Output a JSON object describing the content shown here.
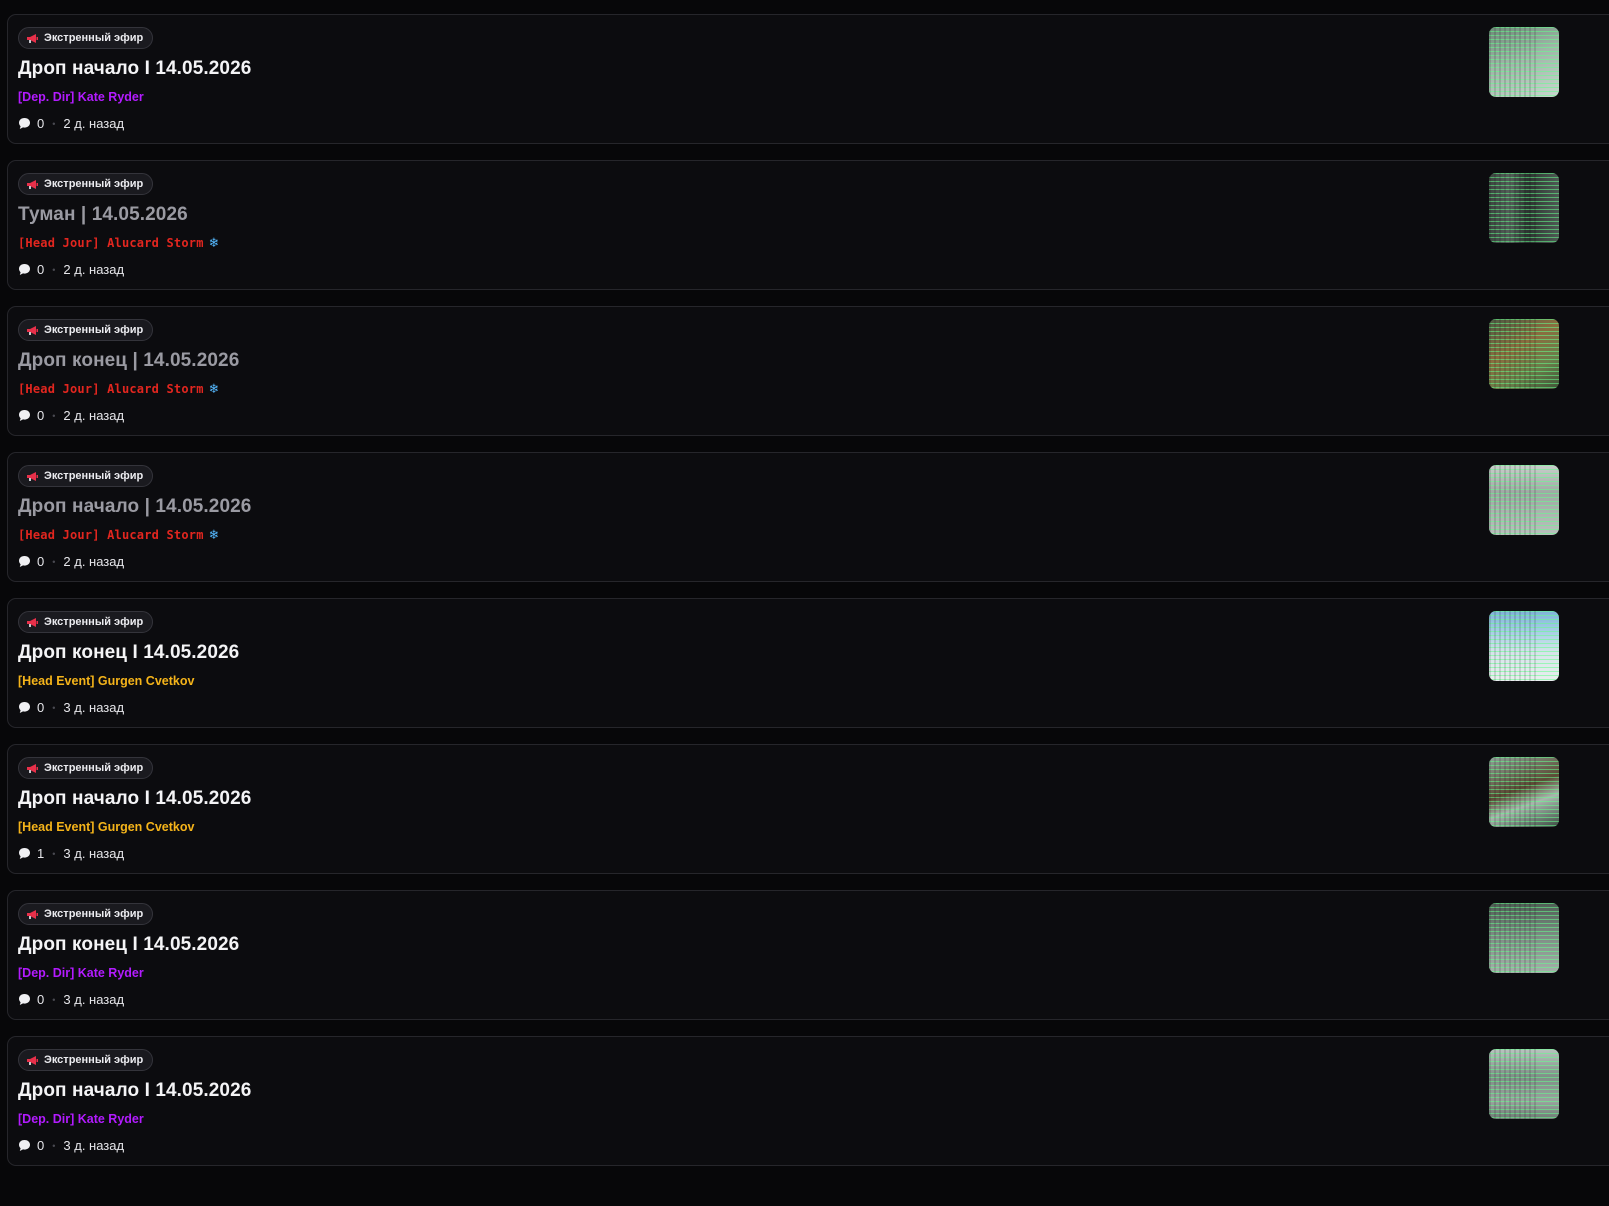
{
  "badge_label": "Экстренный эфир",
  "colors": {
    "dep_dir": "#b31bff",
    "head_jour": "#e2261f",
    "head_event": "#f5b41a",
    "snowflake": "#55b9ff"
  },
  "threads": [
    {
      "badge": "Экстренный эфир",
      "badge_icon": "megaphone-icon",
      "title": "Дроп начало I 14.05.2026",
      "read": false,
      "author": "[Dep. Dir] Kate Ryder",
      "author_color": "#b31bff",
      "author_style": "normal",
      "author_icon": "",
      "comments": "0",
      "time": "2 д. назад",
      "thumb_bg": "linear-gradient(160deg,#6d8a78 0%,#9fb5a8 45%,#c9d6cf 100%)"
    },
    {
      "badge": "Экстренный эфир",
      "badge_icon": "megaphone-icon",
      "title": "Туман | 14.05.2026",
      "read": true,
      "author": "[Head Jour] Alucard Storm",
      "author_color": "#e2261f",
      "author_style": "pixel",
      "author_icon": "❄",
      "comments": "0",
      "time": "2 д. назад",
      "thumb_bg": "linear-gradient(90deg,#3c4440 0%,#55605a 30%,#2c3330 55%,#4f5a55 100%)"
    },
    {
      "badge": "Экстренный эфир",
      "badge_icon": "megaphone-icon",
      "title": "Дроп конец | 14.05.2026",
      "read": true,
      "author": "[Head Jour] Alucard Storm",
      "author_color": "#e2261f",
      "author_style": "pixel",
      "author_icon": "❄",
      "comments": "0",
      "time": "2 д. назад",
      "thumb_bg": "linear-gradient(150deg,#4d5a44 0%,#8a6d3f 40%,#6b7d4a 70%,#3f5237 100%)"
    },
    {
      "badge": "Экстренный эфир",
      "badge_icon": "megaphone-icon",
      "title": "Дроп начало | 14.05.2026",
      "read": true,
      "author": "[Head Jour] Alucard Storm",
      "author_color": "#e2261f",
      "author_style": "pixel",
      "author_icon": "❄",
      "comments": "0",
      "time": "2 д. назад",
      "thumb_bg": "linear-gradient(180deg,#c9cfcc 0%,#9fa8a4 40%,#b9c1bd 100%)"
    },
    {
      "badge": "Экстренный эфир",
      "badge_icon": "megaphone-icon",
      "title": "Дроп конец I 14.05.2026",
      "read": false,
      "author": "[Head Event] Gurgen Cvetkov",
      "author_color": "#f5b41a",
      "author_style": "normal",
      "author_icon": "",
      "comments": "0",
      "time": "3 д. назад",
      "thumb_bg": "linear-gradient(180deg,#7fb4d8 0%,#a8cfe6 30%,#d7e4ea 60%,#e9eeef 100%)"
    },
    {
      "badge": "Экстренный эфир",
      "badge_icon": "megaphone-icon",
      "title": "Дроп начало I 14.05.2026",
      "read": false,
      "author": "[Head Event] Gurgen Cvetkov",
      "author_color": "#f5b41a",
      "author_style": "normal",
      "author_icon": "",
      "comments": "1",
      "time": "3 д. назад",
      "thumb_bg": "linear-gradient(160deg,#8fa39a 0%,#5c4a35 45%,#a9b6ae 65%,#3d4a43 100%)"
    },
    {
      "badge": "Экстренный эфир",
      "badge_icon": "megaphone-icon",
      "title": "Дроп конец I 14.05.2026",
      "read": false,
      "author": "[Dep. Dir] Kate Ryder",
      "author_color": "#b31bff",
      "author_style": "normal",
      "author_icon": "",
      "comments": "0",
      "time": "3 д. назад",
      "thumb_bg": "linear-gradient(180deg,#4f5d55 0%,#7b8a82 45%,#a6b0ab 100%)"
    },
    {
      "badge": "Экстренный эфир",
      "badge_icon": "megaphone-icon",
      "title": "Дроп начало I 14.05.2026",
      "read": false,
      "author": "[Dep. Dir] Kate Ryder",
      "author_color": "#b31bff",
      "author_style": "normal",
      "author_icon": "",
      "comments": "0",
      "time": "3 д. назад",
      "thumb_bg": "linear-gradient(180deg,#b9c4c0 0%,#7f8e87 40%,#9aa39f 75%,#6f7b75 100%)"
    }
  ]
}
